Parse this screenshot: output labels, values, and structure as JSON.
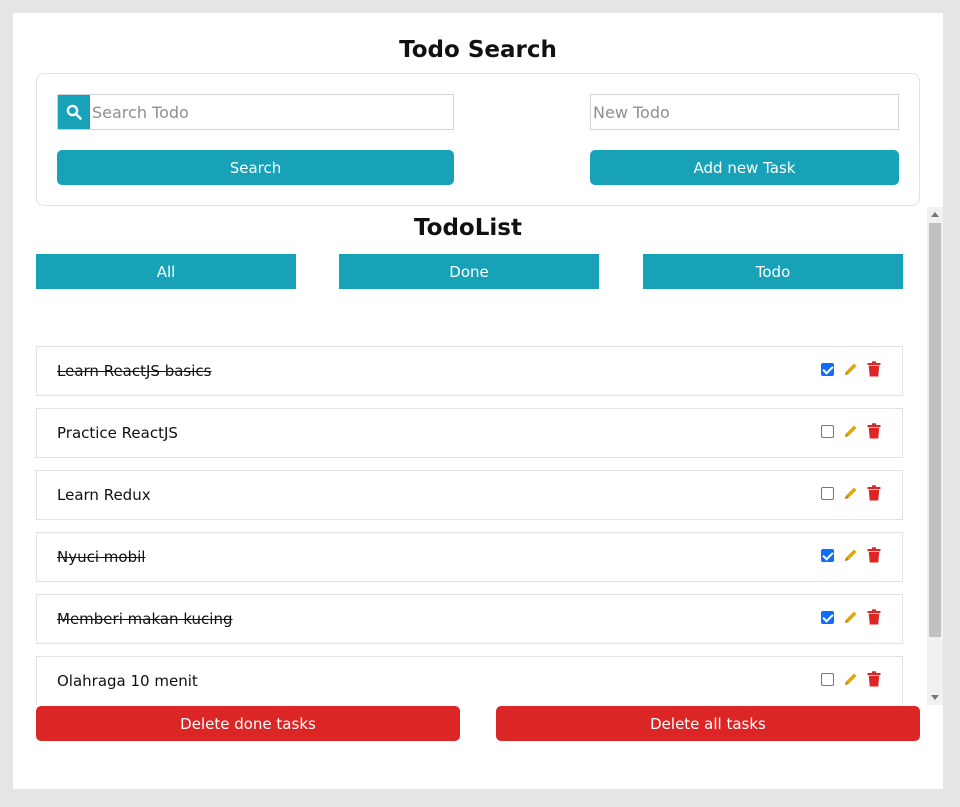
{
  "header": {
    "title": "Todo Search"
  },
  "search": {
    "placeholder": "Search Todo",
    "value": "",
    "button_label": "Search"
  },
  "new_todo": {
    "placeholder": "New Todo",
    "value": "",
    "button_label": "Add new Task"
  },
  "list": {
    "title": "TodoList",
    "filters": [
      "All",
      "Done",
      "Todo"
    ],
    "items": [
      {
        "text": "Learn ReactJS basics",
        "done": true
      },
      {
        "text": "Practice ReactJS",
        "done": false
      },
      {
        "text": "Learn Redux",
        "done": false
      },
      {
        "text": "Nyuci mobil",
        "done": true
      },
      {
        "text": "Memberi makan kucing",
        "done": true
      },
      {
        "text": "Olahraga 10 menit",
        "done": false
      }
    ]
  },
  "actions": {
    "delete_done_label": "Delete done tasks",
    "delete_all_label": "Delete all tasks"
  },
  "icons": {
    "search": "search-icon",
    "edit": "pencil-icon",
    "delete": "trash-icon"
  },
  "colors": {
    "accent": "#17a2b8",
    "danger": "#dc2626",
    "edit": "#e0a800",
    "delete": "#dc2626",
    "checkbox": "#0d6efd"
  }
}
